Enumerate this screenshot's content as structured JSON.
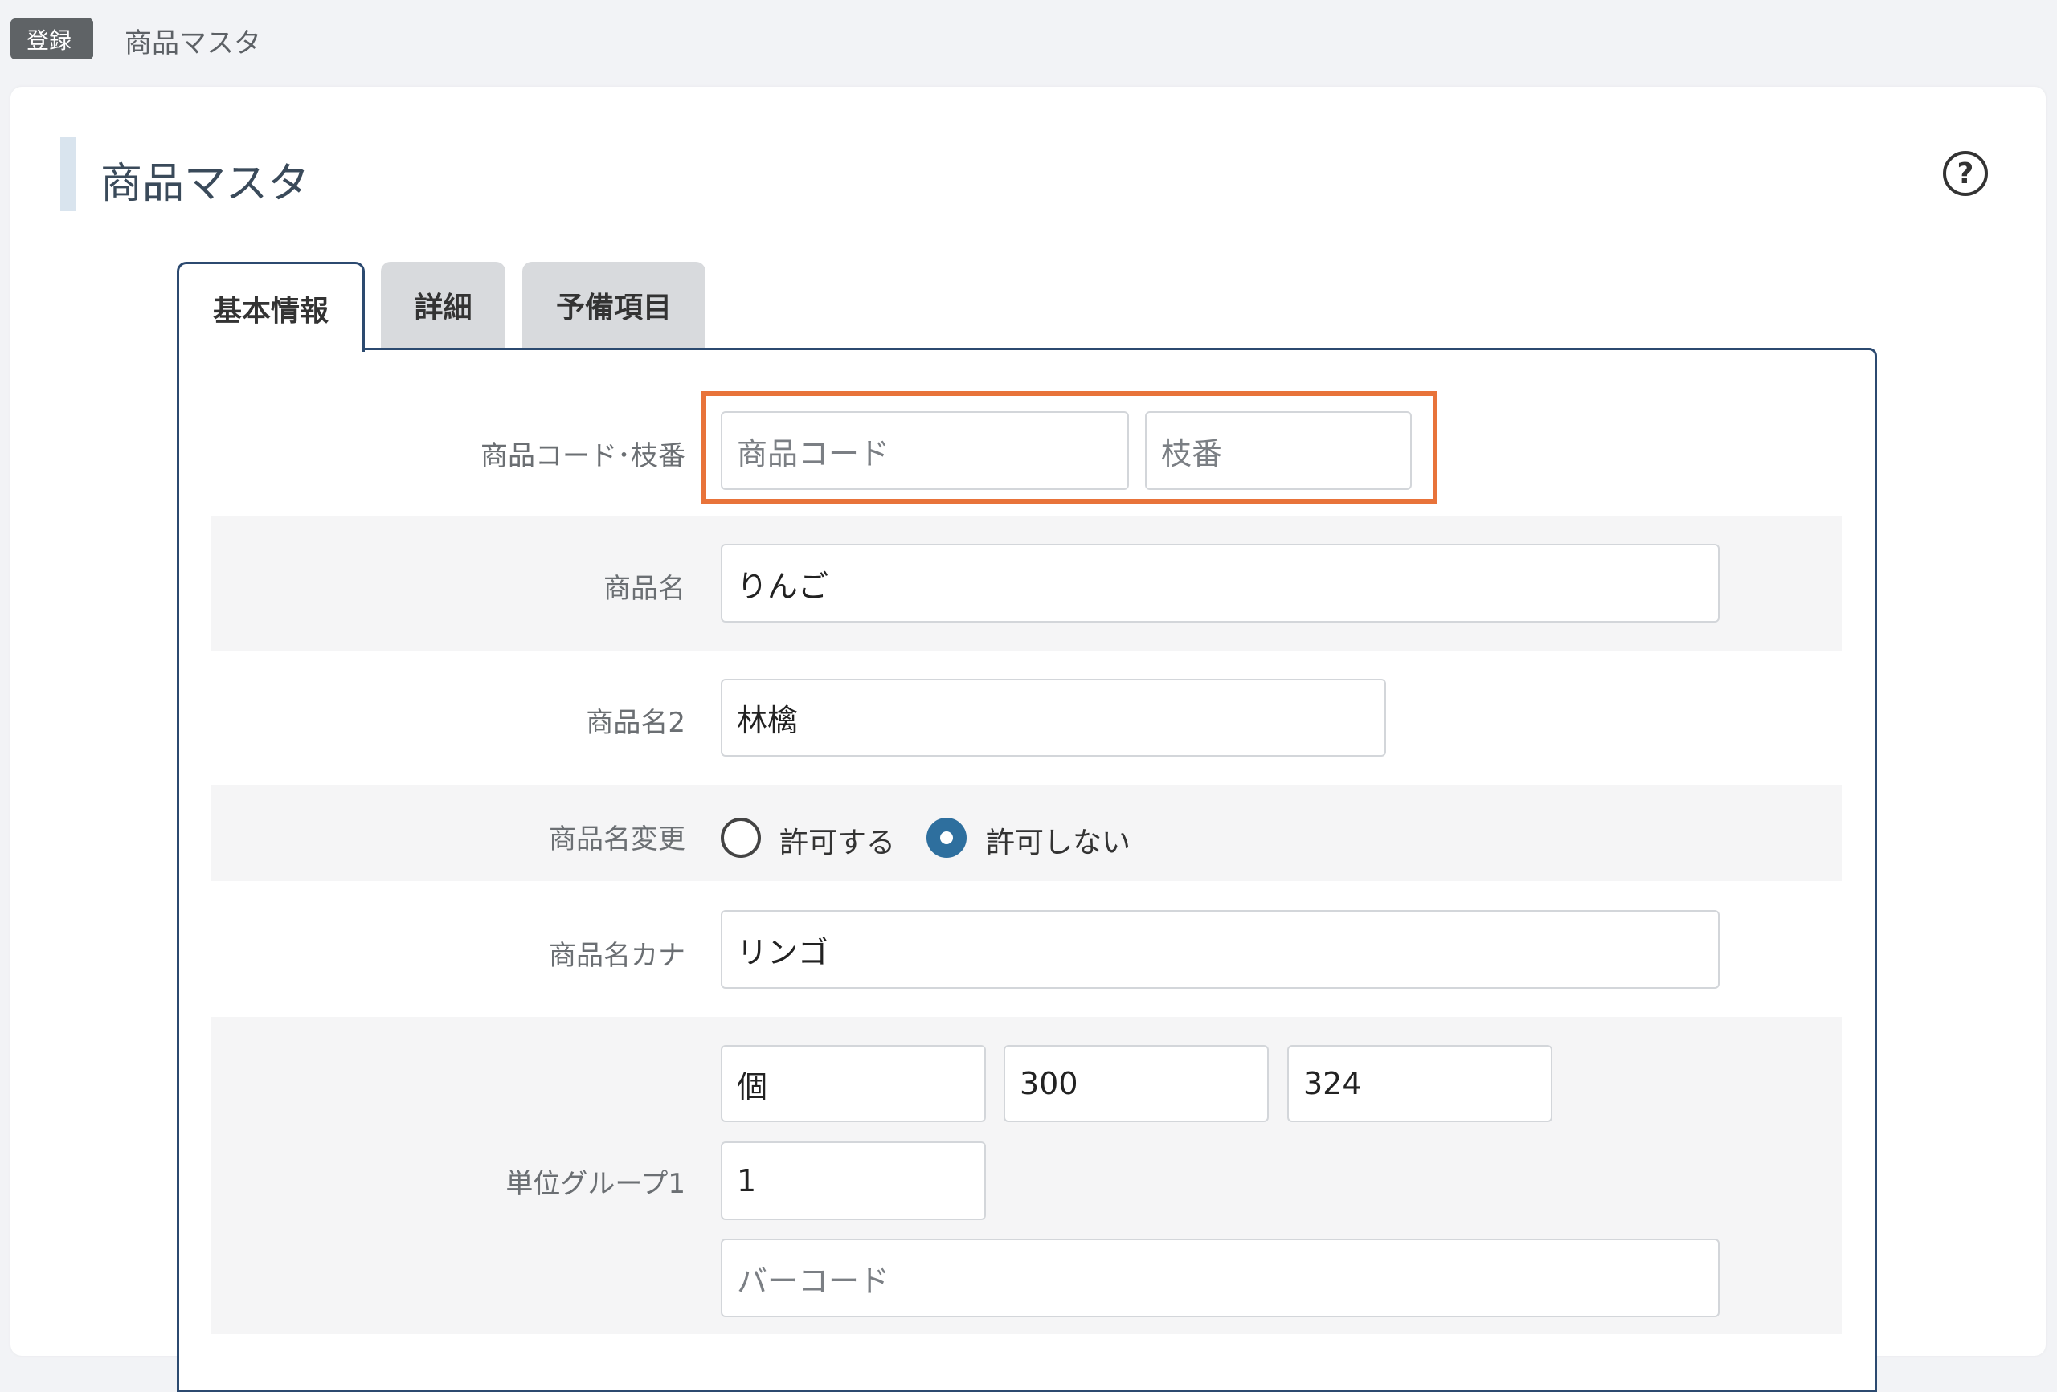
{
  "breadcrumb": {
    "badge": "登録",
    "current": "商品マスタ"
  },
  "page": {
    "title": "商品マスタ",
    "help_symbol": "?"
  },
  "tabs": [
    {
      "label": "基本情報",
      "active": true
    },
    {
      "label": "詳細",
      "active": false
    },
    {
      "label": "予備項目",
      "active": false
    }
  ],
  "form": {
    "code": {
      "label": "商品コード･枝番",
      "code_placeholder": "商品コード",
      "branch_placeholder": "枝番"
    },
    "name": {
      "label": "商品名",
      "value": "りんご"
    },
    "name2": {
      "label": "商品名2",
      "value": "林檎"
    },
    "name_change": {
      "label": "商品名変更",
      "options": [
        {
          "label": "許可する",
          "selected": false
        },
        {
          "label": "許可しない",
          "selected": true
        }
      ]
    },
    "name_kana": {
      "label": "商品名カナ",
      "value": "リンゴ"
    },
    "unit_group1": {
      "label": "単位グループ1",
      "unit": "個",
      "price1": "300",
      "price2": "324",
      "quantity": "1",
      "barcode_placeholder": "バーコード"
    }
  },
  "colors": {
    "highlight": "#e8733a",
    "accent": "#2e6f9e",
    "border": "#2c4a70"
  }
}
